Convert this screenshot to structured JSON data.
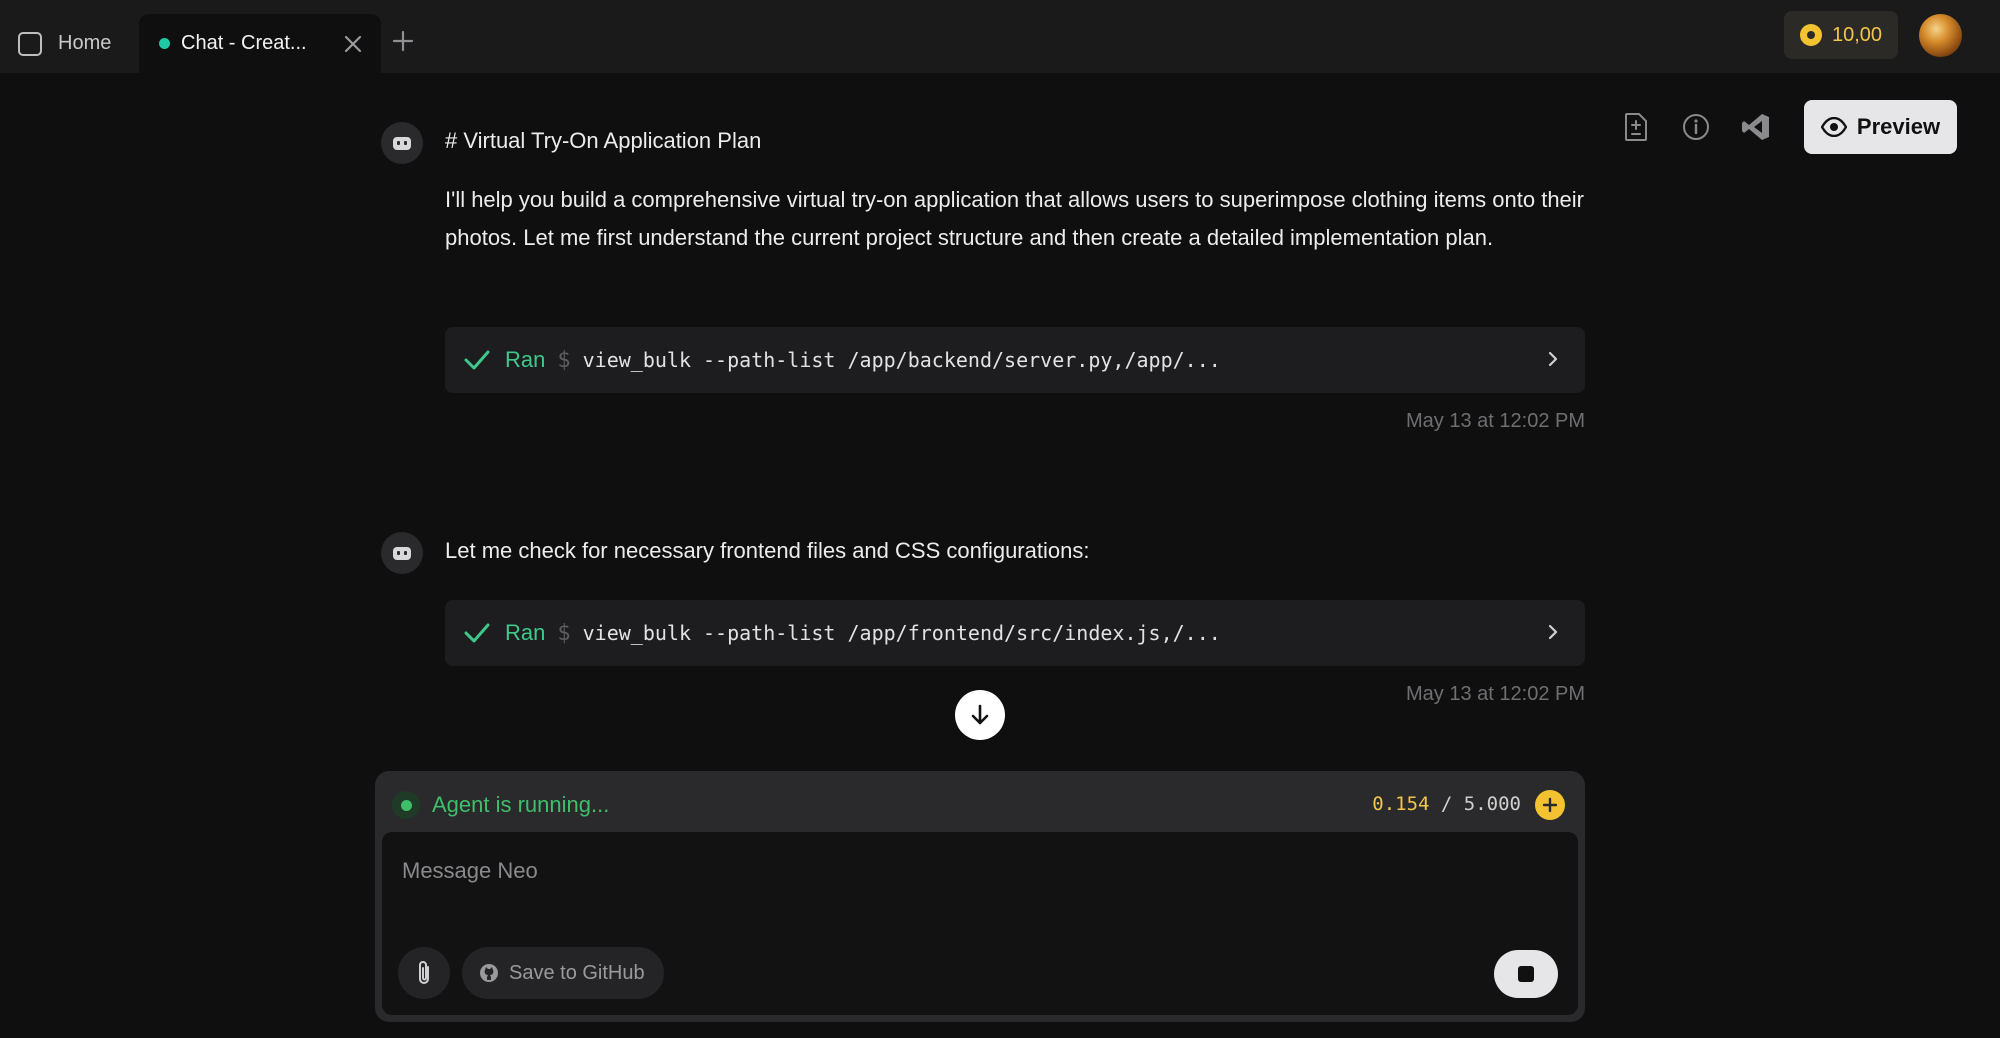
{
  "tabs": {
    "home_label": "Home",
    "chat_label": "Chat - Creat..."
  },
  "header": {
    "credits": "10,00"
  },
  "toolbar": {
    "preview_label": "Preview"
  },
  "messages": [
    {
      "heading": "# Virtual Try-On Application Plan",
      "body": "I'll help you build a comprehensive virtual try-on application that allows users to superimpose clothing items onto their photos. Let me first understand the current project structure and then create a detailed implementation plan.",
      "command": {
        "status": "Ran",
        "prompt": "$",
        "text": "view_bulk --path-list /app/backend/server.py,/app/..."
      },
      "timestamp": "May 13 at 12:02 PM"
    },
    {
      "body": "Let me check for necessary frontend files and CSS configurations:",
      "command": {
        "status": "Ran",
        "prompt": "$",
        "text": "view_bulk --path-list /app/frontend/src/index.js,/..."
      },
      "timestamp": "May 13 at 12:02 PM"
    }
  ],
  "composer": {
    "status": "Agent is running...",
    "usage_used": "0.154",
    "usage_sep": " / ",
    "usage_total": "5.000",
    "placeholder": "Message Neo",
    "github_label": "Save to GitHub"
  },
  "colors": {
    "accent_green": "#3fbf6b",
    "tab_dot": "#1fc9a6",
    "coin": "#f2c230"
  }
}
